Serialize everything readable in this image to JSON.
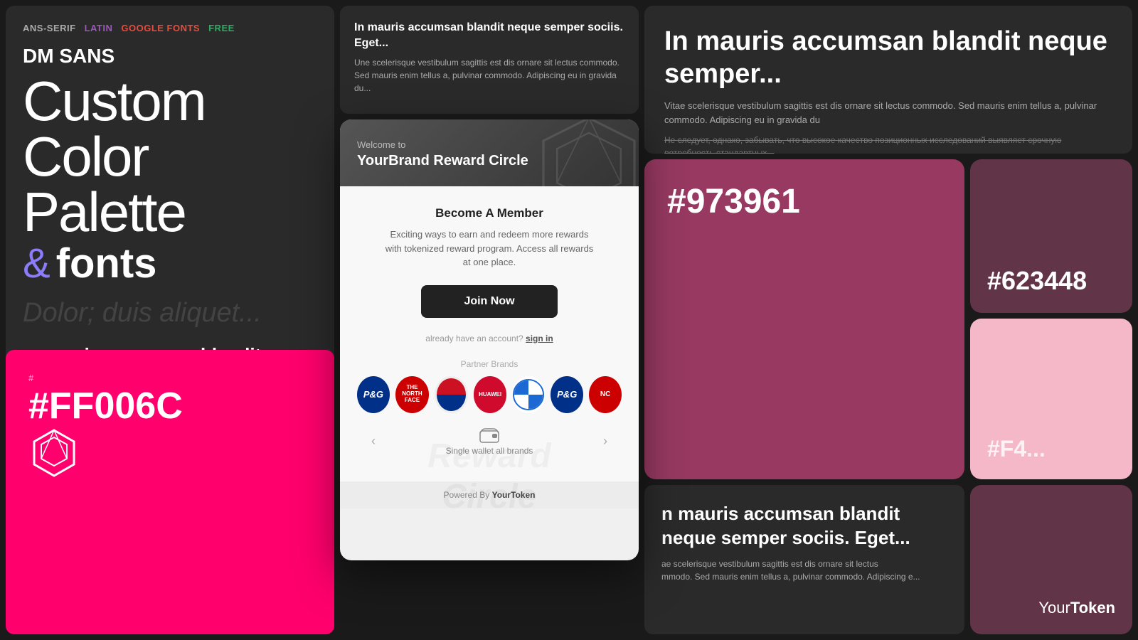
{
  "tags": {
    "sans": "ANS-SERIF",
    "latin": "LATIN",
    "google": "GOOGLE FONTS",
    "free": "FREE"
  },
  "font": {
    "name": "DM SANS",
    "heading1": "Custom Color Palette",
    "heading2": "& fonts",
    "sample": "Dolor; duis aliquet...",
    "section_heading": "n mauris accumsan blandit\neque semper sociis. Eget...",
    "body": "ae scelerisque vestibulum sagittis est dis ornare sit lectus\nmmodo. Sed mauris enim tellus a, pulvinar commodo. Adipiscing e...",
    "strikethrough": "следует, однако, забывать, что высокое качество позиционных\nиследований выявляет срочную потребность стандартных..."
  },
  "center_top": {
    "title": "In mauris accumsan blandit\nneque semper sociis. Eget...",
    "body": "Une scelerisque vestibulum sagittis est dis ornare sit lectus commodo. Sed mauris enim tellus a, pulvinar commodo. Adipiscing eu in gravida du..."
  },
  "modal": {
    "welcome": "Welcome to",
    "brand": "YourBrand Reward Circle",
    "subtitle": "Become A Member",
    "description": "Exciting ways to earn and redeem more rewards with tokenized reward program. Access all rewards at one place.",
    "join_btn": "Join Now",
    "already_text": "already have an account?",
    "sign_in": "sign in",
    "partner_label": "Partner Brands",
    "partners": [
      "P&G",
      "TNF",
      "Pepsi",
      "HUAWEI",
      "BMW",
      "P&G",
      "NC"
    ],
    "wallet_text": "Single wallet all brands",
    "footer_pre": "Powered By ",
    "footer_brand": "YourToken"
  },
  "right_top": {
    "heading": "In mauris accumsan blandit neque semper...",
    "body": "Vitae scelerisque vestibulum sagittis est dis ornare sit lectus commodo. Sed mauris enim tellus a, pulvinar commodo. Adipiscing eu in gravida du",
    "strikethrough": "Не следует, однако, забывать, что высокое качество позиционных исследований выявляет срочную потребность стандартных..."
  },
  "colors": {
    "pink_hex": "#FF006C",
    "color_973": "#973961",
    "color_623": "#623448",
    "color_f4": "#F4..."
  },
  "your_token": {
    "pre": "Your",
    "bold": "Token"
  }
}
